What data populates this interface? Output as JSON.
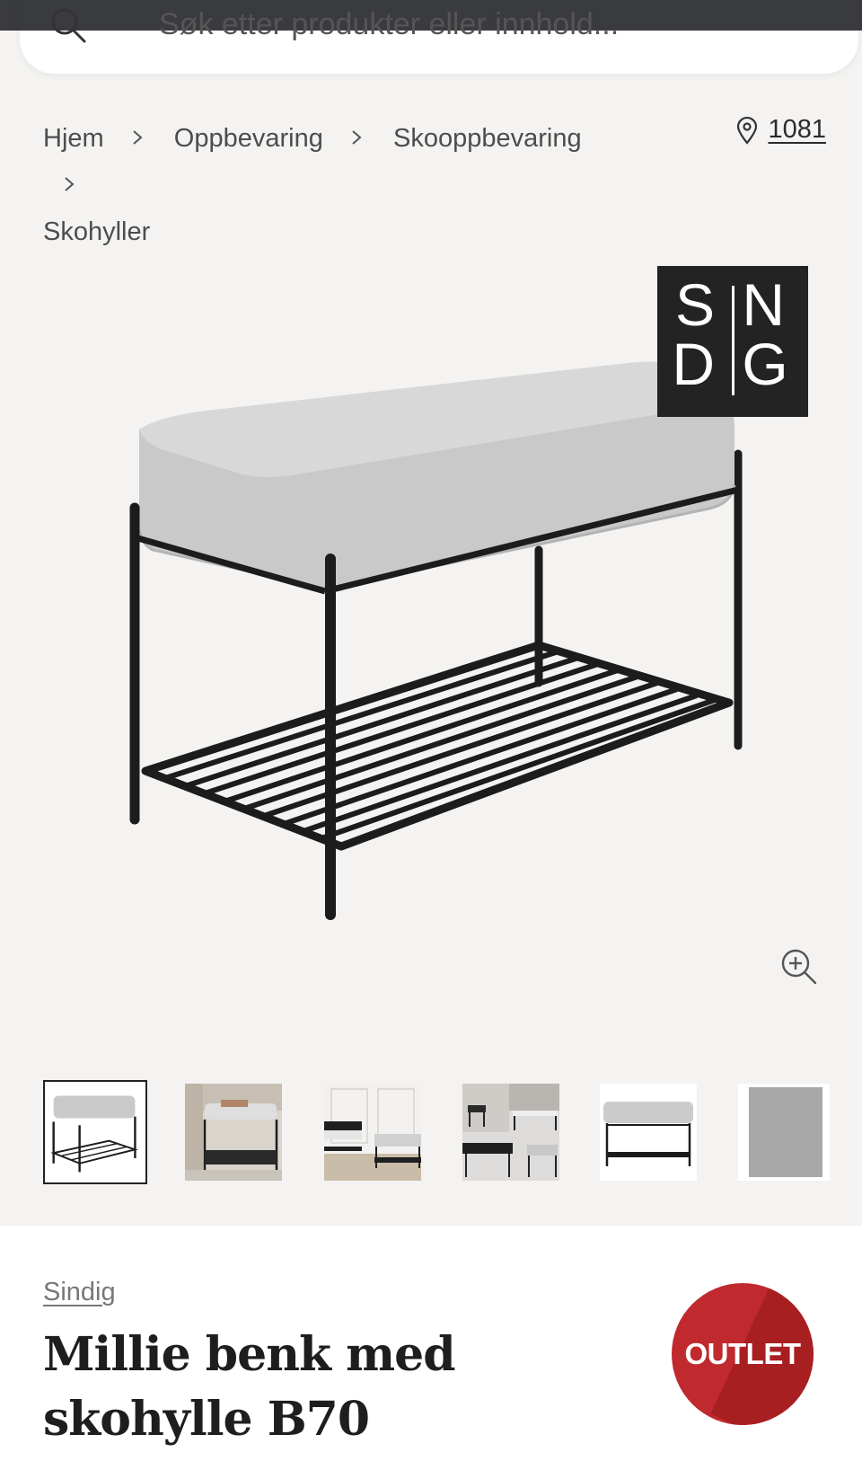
{
  "search": {
    "placeholder": "Søk etter produkter eller innhold..."
  },
  "breadcrumb": {
    "items": [
      "Hjem",
      "Oppbevaring",
      "Skooppbevaring",
      "Skohyller"
    ]
  },
  "store": {
    "number": "1081"
  },
  "product": {
    "brand_badge": "SINDIG",
    "brand": "Sindig",
    "title": "Millie benk med skohylle B70",
    "badge": "OUTLET",
    "thumbnail_count": 6,
    "selected_thumbnail": 1
  },
  "colors": {
    "topbar": "#3a3b3f",
    "background": "#f4f3f1",
    "outlet_red": "#c02a2e"
  }
}
